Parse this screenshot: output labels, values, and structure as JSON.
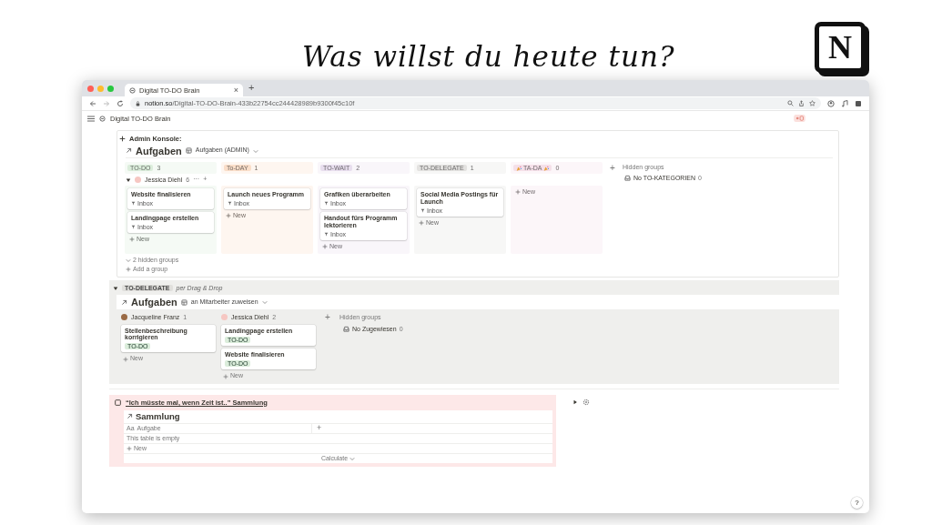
{
  "overlay": {
    "headline": "Was willst du heute tun?",
    "logo_letter": "N"
  },
  "browser": {
    "tab": {
      "title": "Digital TO-DO Brain",
      "close": "×",
      "selected": true
    },
    "new_tab": "+",
    "url": "**notion.so**/Digital-TO-DO-Brain-433b22754cc244428989b9300f45c10f"
  },
  "topbar": {
    "page_title": "Digital TO-DO Brain"
  },
  "admin": {
    "heading": "Admin Konsole:",
    "database_title": "Aufgaben",
    "view": "Aufgaben (ADMIN)",
    "columns": [
      {
        "label": "TO-DO",
        "count": "3",
        "color": "#dbeddb",
        "kind": "plain",
        "cards": [
          {
            "title": "Website finalisieren",
            "tag": "Inbox"
          },
          {
            "title": "Landingpage erstellen",
            "tag": "Inbox"
          }
        ],
        "new_label": "New"
      },
      {
        "label": "To-DAY",
        "count": "1",
        "color": "#fadec9",
        "kind": "plain",
        "cards": [
          {
            "title": "Launch neues Programm",
            "tag": "Inbox"
          }
        ],
        "new_label": "New"
      },
      {
        "label": "TO-WAIT",
        "count": "2",
        "color": "#e8deee",
        "kind": "plain",
        "cards": [
          {
            "title": "Grafiken überarbeiten",
            "tag": "Inbox"
          },
          {
            "title": "Handout fürs Programm lektorieren",
            "tag": "Inbox"
          }
        ],
        "new_label": "New"
      },
      {
        "label": "TO-DELEGATE",
        "count": "1",
        "color": "#e3e2e0",
        "kind": "plain",
        "cards": [
          {
            "title": "Social Media Postings für Launch",
            "tag": "Inbox"
          }
        ],
        "new_label": "New"
      },
      {
        "label": "TA-DA",
        "count": "0",
        "color": "#f5e0e9",
        "kind": "party",
        "new_label": "New"
      }
    ],
    "group": {
      "name": "Jessica Diehl",
      "count": "6",
      "expanded": true,
      "more": "···",
      "add": "+"
    },
    "add_column": "+",
    "hidden_label": "Hidden groups",
    "hidden_groups": [
      {
        "label": "No TO-KATEGORIEN",
        "count": "0"
      }
    ],
    "hidden_toggle": "2 hidden groups",
    "add_group": "Add a group"
  },
  "delegate": {
    "expanded": true,
    "tag": "TO-DELEGATE",
    "note": "per Drag & Drop",
    "database_title": "Aufgaben",
    "view": "an Mitarbeiter zuweisen",
    "columns": [
      {
        "name": "Jacqueline Franz",
        "count": "1",
        "kind": "photo",
        "cards": [
          {
            "title": "Stellenbeschreibung korrigieren",
            "tag": "TO-DO"
          }
        ],
        "new_label": "New"
      },
      {
        "name": "Jessica Diehl",
        "count": "2",
        "kind": "initial",
        "cards": [
          {
            "title": "Landingpage erstellen",
            "tag": "TO-DO"
          },
          {
            "title": "Website finalisieren",
            "tag": "TO-DO"
          }
        ],
        "new_label": "New"
      }
    ],
    "add_column": "+",
    "hidden_label": "Hidden groups",
    "hidden_groups": [
      {
        "label": "No Zugewiesen",
        "count": "0"
      }
    ]
  },
  "callout": {
    "checked": false,
    "link": "“Ich müsste mal, wenn Zeit ist..” Sammlung",
    "table_title": "Sammlung",
    "column_type": "Aa",
    "column": "Aufgabe",
    "add_column": "+",
    "empty": "This table is empty",
    "new_label": "New",
    "calculate": "Calculate"
  },
  "side_toggle": {
    "expanded": false
  },
  "help": "?"
}
